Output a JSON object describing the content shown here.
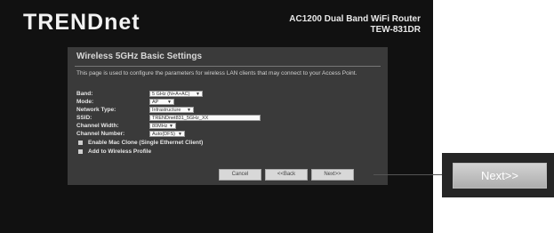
{
  "header": {
    "logo": "TRENDnet",
    "model_line1": "AC1200 Dual Band WiFi Router",
    "model_line2": "TEW-831DR"
  },
  "panel": {
    "title": "Wireless 5GHz Basic Settings",
    "description": "This page is used to configure the parameters for wireless LAN clients that may connect to your Access Point."
  },
  "fields": {
    "band_label": "Band:",
    "band_value": "5 GHz (N+A+AC)",
    "mode_label": "Mode:",
    "mode_value": "AP",
    "network_type_label": "Network Type:",
    "network_type_value": "Infrastructure",
    "ssid_label": "SSID:",
    "ssid_value": "TRENDnet831_5GHz_XX",
    "channel_width_label": "Channel Width:",
    "channel_width_value": "80MHz",
    "channel_number_label": "Channel Number:",
    "channel_number_value": "Auto(DFS)"
  },
  "checkboxes": {
    "mac_clone": "Enable Mac Clone (Single Ethernet Client)",
    "add_profile": "Add to Wireless Profile"
  },
  "buttons": {
    "cancel": "Cancel",
    "back": "<<Back",
    "next": "Next>>"
  },
  "callout": {
    "label": "Next>>"
  }
}
